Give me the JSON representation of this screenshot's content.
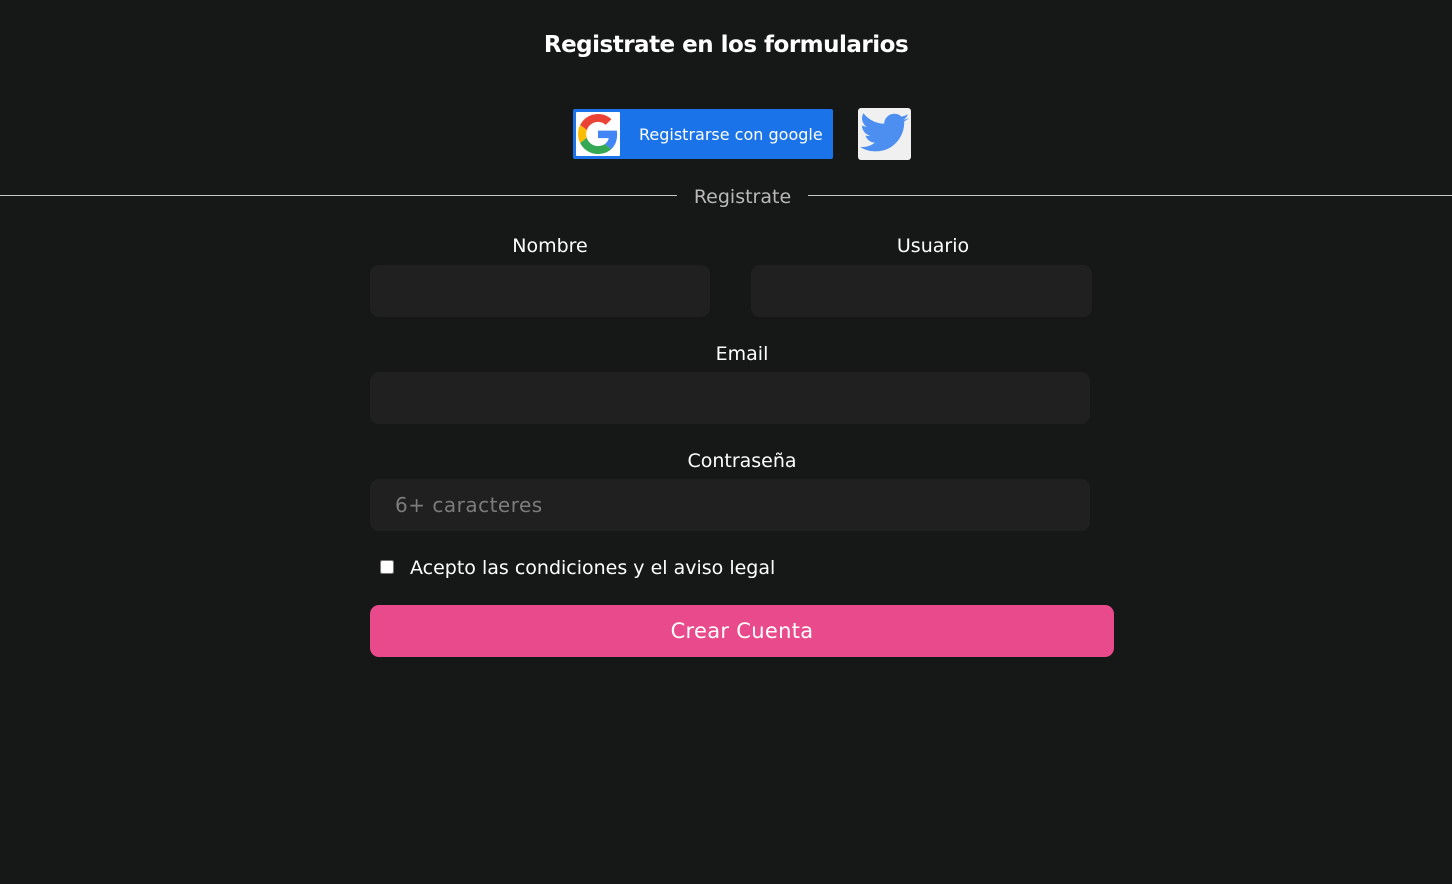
{
  "header": {
    "title": "Registrate en los formularios"
  },
  "social": {
    "google_label": "Registrarse con google",
    "google_icon": "google-g-logo",
    "twitter_icon": "twitter-bird-logo",
    "google_color": "#1a73e8",
    "twitter_color": "#4d8ff0"
  },
  "divider": {
    "label": "Registrate"
  },
  "form": {
    "nombre_label": "Nombre",
    "nombre_value": "",
    "usuario_label": "Usuario",
    "usuario_value": "",
    "email_label": "Email",
    "email_value": "",
    "password_label": "Contraseña",
    "password_placeholder": "6+ caracteres",
    "terms_label": "Acepto las condiciones y el aviso legal",
    "terms_checked": false,
    "submit_label": "Crear Cuenta",
    "submit_color": "#e84a8b"
  }
}
